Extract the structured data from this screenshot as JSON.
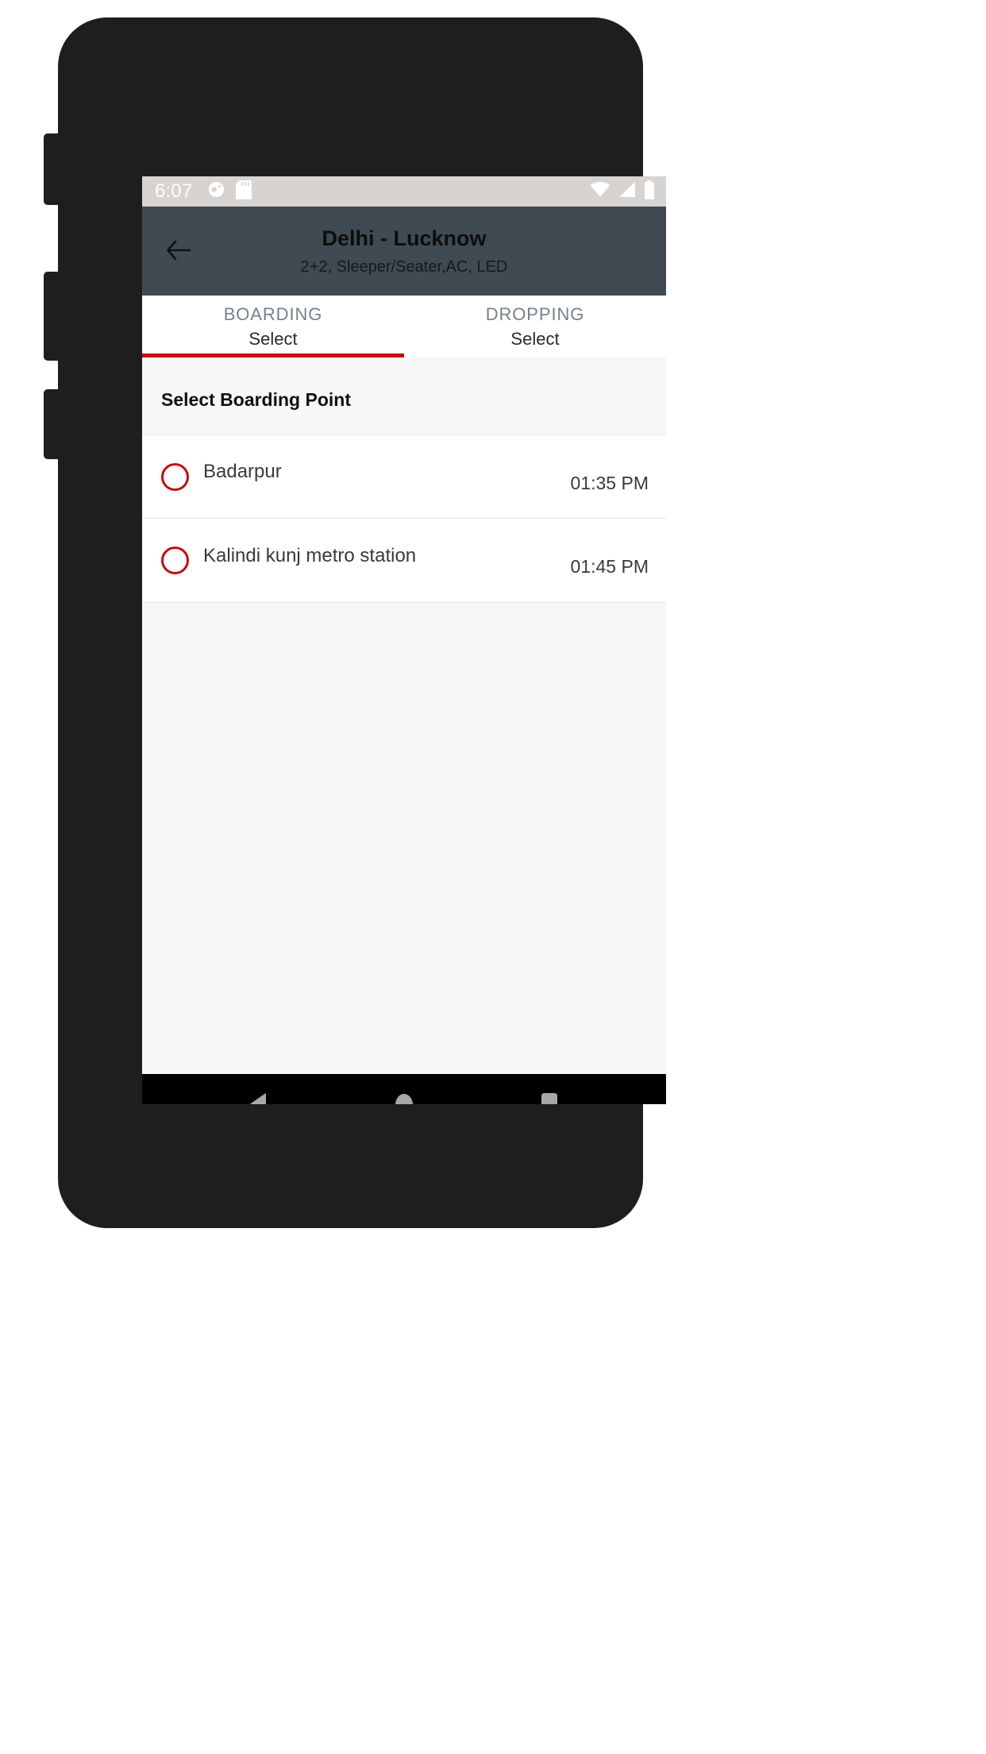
{
  "status_bar": {
    "time": "6:07",
    "left_icons": [
      "do-not-disturb-icon",
      "sd-card-icon"
    ],
    "right_icons": [
      "wifi-icon",
      "signal-icon",
      "battery-icon"
    ],
    "background_color": "#d6d3d1"
  },
  "app_bar": {
    "back_icon": "back-arrow-icon",
    "title": "Delhi - Lucknow",
    "subtitle": "2+2, Sleeper/Seater,AC, LED",
    "background_color": "#3f4a52"
  },
  "tabs": [
    {
      "title": "BOARDING",
      "value": "Select",
      "active": true
    },
    {
      "title": "DROPPING",
      "value": "Select",
      "active": false
    }
  ],
  "accent_color": "#c50d0d",
  "content": {
    "section_title": "Select Boarding Point",
    "points": [
      {
        "name": "Badarpur",
        "time": "01:35 PM",
        "selected": false
      },
      {
        "name": "Kalindi kunj metro station",
        "time": "01:45 PM",
        "selected": false
      }
    ]
  },
  "nav_bar": {
    "buttons": [
      "back-triangle-icon",
      "home-circle-icon",
      "recents-square-icon"
    ]
  }
}
